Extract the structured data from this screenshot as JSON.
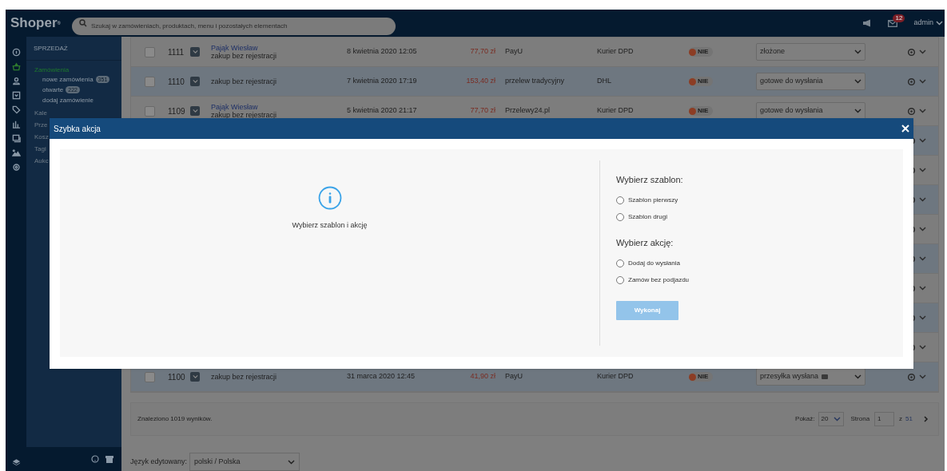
{
  "topbar": {
    "logo": "Shoper",
    "logo_mark": "®",
    "search": {
      "placeholder": "Szukaj w zamówieniach, produktach, menu i pozostałych elementach"
    },
    "messages_badge": "12",
    "user": "admin"
  },
  "sidebar": {
    "section": "SPRZEDAŻ",
    "items": [
      {
        "label": "Zamówienia",
        "selected": true,
        "children": [
          {
            "label": "nowe zamówienia",
            "badge": "351"
          },
          {
            "label": "otwarte",
            "badge": "222"
          },
          {
            "label": "dodaj zamówienie"
          }
        ]
      },
      {
        "label": "Kale",
        "selected": false
      },
      {
        "label": "Prze",
        "selected": false
      },
      {
        "label": "Kosz",
        "selected": false
      },
      {
        "label": "Tagi",
        "selected": false
      },
      {
        "label": "Aukc",
        "selected": false
      }
    ]
  },
  "table": {
    "rows": [
      {
        "kind": "order",
        "checked": false,
        "id": "1111",
        "customer_name": "Pająk Wiesław",
        "customer_type": "zakup bez rejestracji",
        "date": "8 kwietnia 2020 12:05",
        "amount": "77,70 zł",
        "payment": "PayU",
        "shipping": "Kurier DPD",
        "paid": "NIE",
        "status": "złożone"
      },
      {
        "kind": "order",
        "checked": false,
        "id": "1110",
        "customer_type": "zakup bez rejestracji",
        "date": "7 kwietnia 2020 17:19",
        "amount": "153,40 zł",
        "payment": "przelew tradycyjny",
        "shipping": "DHL",
        "paid": "NIE",
        "status": "gotowe do wysłania"
      },
      {
        "kind": "order",
        "checked": false,
        "id": "1109",
        "customer_name": "Pająk Wiesław",
        "customer_type": "zakup bez rejestracji",
        "date": "5 kwietnia 2020 21:17",
        "amount": "77,70 zł",
        "payment": "Przelewy24.pl",
        "shipping": "Kurier DPD",
        "paid": "NIE",
        "status": "gotowe do wysłania"
      },
      {
        "kind": "covered"
      },
      {
        "kind": "covered"
      },
      {
        "kind": "covered"
      },
      {
        "kind": "covered"
      },
      {
        "kind": "covered"
      },
      {
        "kind": "covered"
      },
      {
        "kind": "covered"
      },
      {
        "kind": "covered"
      },
      {
        "kind": "order",
        "checked": false,
        "id": "1100",
        "customer_type": "zakup bez rejestracji",
        "date": "31 marca 2020 12:45",
        "amount": "41,90 zł",
        "payment": "PayU",
        "shipping": "Kurier DPD",
        "paid": "NIE",
        "status": "przesyłka wysłana",
        "status_tag": true
      }
    ]
  },
  "footer": {
    "found": "Znaleziono 1019 wyników.",
    "show_label": "Pokaż:",
    "per_page": "20",
    "page_label": "Strona",
    "page": "1",
    "of_label": "z",
    "pages": "51"
  },
  "language": {
    "label": "Język edytowany:",
    "value": "polski / Polska"
  },
  "dialog": {
    "title": "Szybka akcja",
    "message": "Wybierz szablon i akcję",
    "groups": [
      {
        "heading": "Wybierz szablon:",
        "options": [
          {
            "label": "Szablon pierwszy",
            "selected": false
          },
          {
            "label": "Szablon drugi",
            "selected": false
          }
        ]
      },
      {
        "heading": "Wybierz akcję:",
        "options": [
          {
            "label": "Dodaj do wysłania",
            "selected": false
          },
          {
            "label": "Zamów bez podjazdu",
            "selected": false
          }
        ]
      }
    ],
    "button": {
      "label": "Wykonaj",
      "disabled": true
    }
  }
}
